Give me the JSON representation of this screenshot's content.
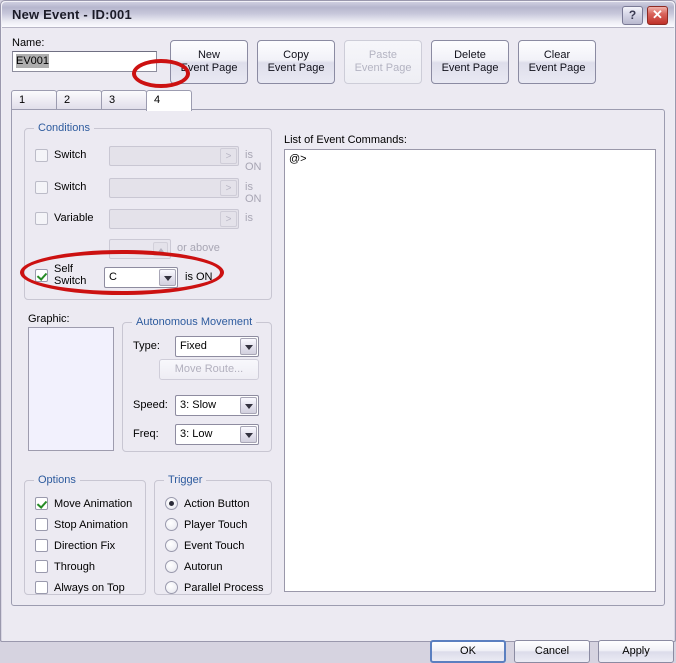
{
  "window": {
    "title": "New Event - ID:001",
    "help_button": "?",
    "close_button": "✕"
  },
  "name_field": {
    "label": "Name:",
    "value": "EV001",
    "selected": true
  },
  "page_buttons": [
    {
      "line1": "New",
      "line2": "Event Page",
      "enabled": true
    },
    {
      "line1": "Copy",
      "line2": "Event Page",
      "enabled": true
    },
    {
      "line1": "Paste",
      "line2": "Event Page",
      "enabled": false
    },
    {
      "line1": "Delete",
      "line2": "Event Page",
      "enabled": true
    },
    {
      "line1": "Clear",
      "line2": "Event Page",
      "enabled": true
    }
  ],
  "tabs": {
    "items": [
      "1",
      "2",
      "3",
      "4"
    ],
    "active": "4"
  },
  "conditions": {
    "legend": "Conditions",
    "rows": [
      {
        "check_label": "Switch",
        "checked": false,
        "field_value": "",
        "suffix": "is ON",
        "enabled": false
      },
      {
        "check_label": "Switch",
        "checked": false,
        "field_value": "",
        "suffix": "is ON",
        "enabled": false
      },
      {
        "check_label": "Variable",
        "checked": false,
        "field_value": "",
        "suffix": "is",
        "enabled": false
      },
      {
        "check_label": "",
        "checked": false,
        "field_value": "",
        "suffix": "or above",
        "enabled": false
      },
      {
        "check_label": "Self Switch",
        "check_label_line1": "Self",
        "check_label_line2": "Switch",
        "checked": true,
        "field_value": "C",
        "suffix": "is ON",
        "enabled": true
      }
    ]
  },
  "graphic": {
    "label": "Graphic:"
  },
  "autonomous_movement": {
    "legend": "Autonomous Movement",
    "type_label": "Type:",
    "type_value": "Fixed",
    "move_route_button": "Move Route...",
    "move_route_enabled": false,
    "speed_label": "Speed:",
    "speed_value": "3: Slow",
    "freq_label": "Freq:",
    "freq_value": "3: Low"
  },
  "options": {
    "legend": "Options",
    "items": [
      {
        "label": "Move Animation",
        "checked": true
      },
      {
        "label": "Stop Animation",
        "checked": false
      },
      {
        "label": "Direction Fix",
        "checked": false
      },
      {
        "label": "Through",
        "checked": false
      },
      {
        "label": "Always on Top",
        "checked": false
      }
    ]
  },
  "trigger": {
    "legend": "Trigger",
    "items": [
      {
        "label": "Action Button",
        "selected": true
      },
      {
        "label": "Player Touch",
        "selected": false
      },
      {
        "label": "Event Touch",
        "selected": false
      },
      {
        "label": "Autorun",
        "selected": false
      },
      {
        "label": "Parallel Process",
        "selected": false
      }
    ]
  },
  "command_list": {
    "label": "List of Event Commands:",
    "content": "@>"
  },
  "dialog_buttons": {
    "ok": "OK",
    "cancel": "Cancel",
    "apply": "Apply"
  },
  "annotations": {
    "color": "#cc1111",
    "targets": [
      "tab-4",
      "self-switch-row"
    ]
  }
}
